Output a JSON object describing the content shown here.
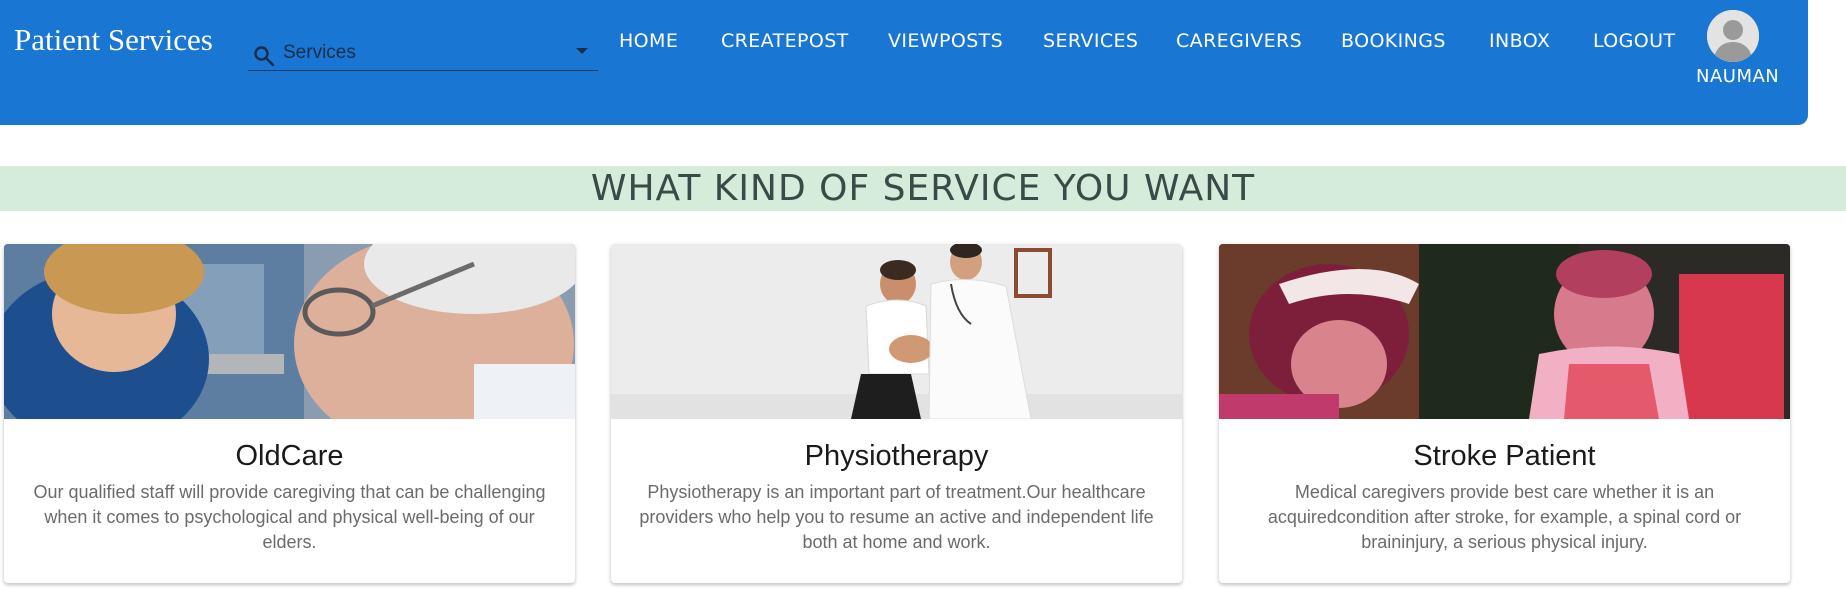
{
  "header": {
    "brand": "Patient Services",
    "search": {
      "value": "",
      "placeholder": "Services"
    },
    "nav": [
      {
        "id": "home",
        "label": "HOME"
      },
      {
        "id": "createpost",
        "label": "CREATEPOST"
      },
      {
        "id": "viewposts",
        "label": "VIEWPOSTS"
      },
      {
        "id": "services",
        "label": "SERVICES"
      },
      {
        "id": "caregivers",
        "label": "CAREGIVERS"
      },
      {
        "id": "bookings",
        "label": "BOOKINGS"
      },
      {
        "id": "inbox",
        "label": "INBOX"
      },
      {
        "id": "logout",
        "label": "LOGOUT"
      }
    ],
    "user": {
      "name": "NAUMAN",
      "avatar_icon": "user-avatar-icon"
    }
  },
  "banner": {
    "title": "WHAT KIND OF SERVICE YOU WANT"
  },
  "services": [
    {
      "title": "OldCare",
      "description": "Our qualified staff will provide caregiving that can be challenging when it comes to psychological and physical well-being of our elders.",
      "image": "nurse-with-elderly-man-photo"
    },
    {
      "title": "Physiotherapy",
      "description": "Physiotherapy is an important part of treatment.Our healthcare providers who help you to resume an active and independent life both at home and work.",
      "image": "doctor-examining-knee-photo"
    },
    {
      "title": "Stroke Patient",
      "description": "Medical caregivers provide best care whether it is an acquiredcondition after stroke, for example, a spinal cord or braininjury, a serious physical injury.",
      "image": "woman-with-child-in-wheelchair-photo"
    }
  ],
  "colors": {
    "appbar": "#1976d2",
    "banner_bg": "#d5ecdb",
    "banner_text": "#3a4a48",
    "card_text": "#6b6b6b"
  }
}
